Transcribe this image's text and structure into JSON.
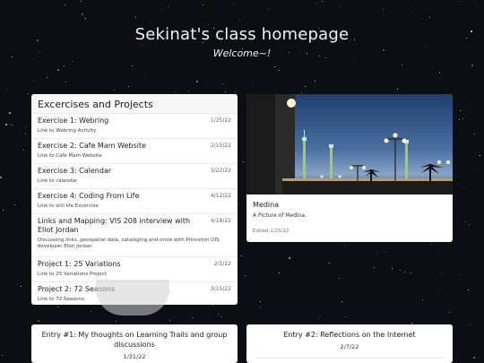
{
  "header": {
    "title": "Sekinat's class homepage",
    "subtitle": "Welcome~!"
  },
  "projects": {
    "heading": "Excercises and Projects",
    "items": [
      {
        "title": "Exercise 1: Webring",
        "date": "1/25/22",
        "desc": "Link to Webring Activity"
      },
      {
        "title": "Exercise 2: Cafe Mam Website",
        "date": "2/15/22",
        "desc": "Link to Cafe Mam Website"
      },
      {
        "title": "Exercise 3: Calendar",
        "date": "3/22/22",
        "desc": "Link to calendar"
      },
      {
        "title": "Exercise 4: Coding From Life",
        "date": "4/12/22",
        "desc": "Link to still life Excercise"
      },
      {
        "title": "Links and Mapping: VIS 208 interview with Eliot Jordan",
        "date": "4/18/22",
        "desc": "Discussing links, geospatial data, cataloging and more with Princeton OIS developer Eliot Jordan"
      },
      {
        "title": "Project 1: 25 Variations",
        "date": "2/1/22",
        "desc": "Link to 25 Variations Project"
      },
      {
        "title": "Project 2: 72 Seasons",
        "date": "3/15/22",
        "desc": "Link to 72 Seasons"
      }
    ]
  },
  "medina": {
    "title": "Medina",
    "desc": "A Picture of Medina.",
    "edited": "Edited 1/25/22"
  },
  "entries": [
    {
      "title": "Entry #1: My thoughts on Learning Trails and group discussions",
      "date": "1/31/22"
    },
    {
      "title": "Entry #2: Reflections on the Internet",
      "date": "2/7/22"
    }
  ]
}
